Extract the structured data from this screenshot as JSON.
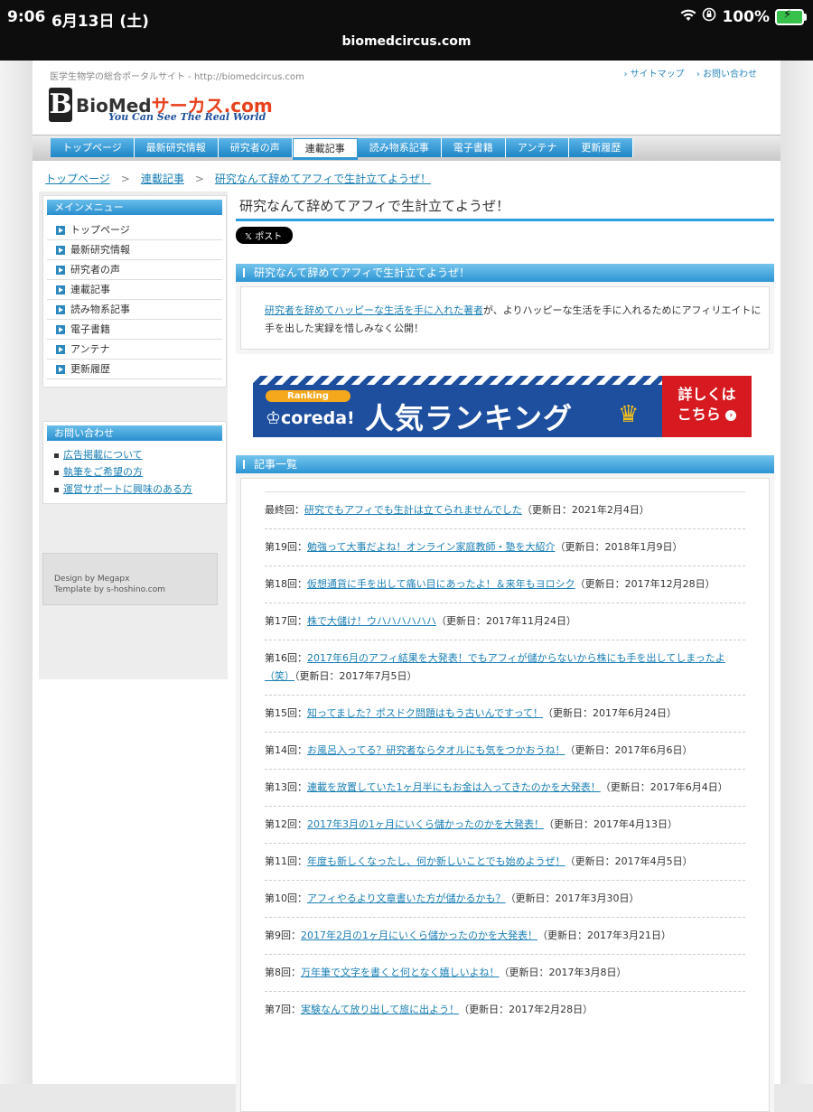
{
  "status": {
    "time": "9:06",
    "date": "6月13日 (土)",
    "battery": "100%"
  },
  "url": "biomedcircus.com",
  "header": {
    "tagline": "医学生物学の総合ポータルサイト - http://biomedcircus.com",
    "links": [
      "サイトマップ",
      "お問い合わせ"
    ],
    "logo_letter": "B",
    "logo_biomed": "BioMed",
    "logo_circus": "サーカス.com",
    "logo_sub": "You Can See The Real World"
  },
  "nav": [
    "トップページ",
    "最新研究情報",
    "研究者の声",
    "連載記事",
    "読み物系記事",
    "電子書籍",
    "アンテナ",
    "更新履歴"
  ],
  "breadcrumb": [
    "トップページ",
    "連載記事",
    "研究なんて辞めてアフィで生計立てようぜ！"
  ],
  "breadcrumb_sep": ">",
  "sidebar": {
    "menu_title": "メインメニュー",
    "menu": [
      "トップページ",
      "最新研究情報",
      "研究者の声",
      "連載記事",
      "読み物系記事",
      "電子書籍",
      "アンテナ",
      "更新履歴"
    ],
    "contact_title": "お問い合わせ",
    "contact": [
      "広告掲載について",
      "執筆をご希望の方",
      "運営サポートに興味のある方"
    ],
    "credit1": "Design by Megapx",
    "credit2": "Template by s-hoshino.com"
  },
  "main": {
    "title": "研究なんて辞めてアフィで生計立てようぜ！",
    "post_btn": "𝕏 ポスト",
    "section1": "研究なんて辞めてアフィで生計立てようぜ！",
    "intro_link": "研究者を辞めてハッピーな生活を手に入れた著者",
    "intro_rest": "が、よりハッピーな生活を手に入れるためにアフィリエイトに手を出した実録を惜しみなく公開！",
    "banner": {
      "ranking": "Ranking",
      "coreda": "♔coreda!",
      "ninki": "人気ランキング",
      "crown": "♛",
      "cta1": "詳しくは",
      "cta2": "こちら",
      "go": "›"
    },
    "section2": "記事一覧"
  },
  "articles": [
    {
      "no": "最終回：",
      "title": "研究でもアフィでも生計は立てられませんでした",
      "date": "（更新日：2021年2月4日）"
    },
    {
      "no": "第19回：",
      "title": "勉強って大事だよね！オンライン家庭教師・塾を大紹介",
      "date": "（更新日：2018年1月9日）"
    },
    {
      "no": "第18回：",
      "title": "仮想通貨に手を出して痛い目にあったよ！＆来年もヨロシク",
      "date": "（更新日：2017年12月28日）"
    },
    {
      "no": "第17回：",
      "title": "株で大儲け！ウハハハハハハ",
      "date": "（更新日：2017年11月24日）"
    },
    {
      "no": "第16回：",
      "title": "2017年6月のアフィ結果を大発表！でもアフィが儲からないから株にも手を出してしまったよ（笑）",
      "date": "（更新日：2017年7月5日）"
    },
    {
      "no": "第15回：",
      "title": "知ってました？ポスドク問題はもう古いんですって！",
      "date": "（更新日：2017年6月24日）"
    },
    {
      "no": "第14回：",
      "title": "お風呂入ってる？研究者ならタオルにも気をつかおうね！",
      "date": "（更新日：2017年6月6日）"
    },
    {
      "no": "第13回：",
      "title": "連載を放置していた1ヶ月半にもお金は入ってきたのかを大発表！",
      "date": "（更新日：2017年6月4日）"
    },
    {
      "no": "第12回：",
      "title": "2017年3月の1ヶ月にいくら儲かったのかを大発表！",
      "date": "（更新日：2017年4月13日）"
    },
    {
      "no": "第11回：",
      "title": "年度も新しくなったし、何か新しいことでも始めようぜ！",
      "date": "（更新日：2017年4月5日）"
    },
    {
      "no": "第10回：",
      "title": "アフィやるより文章書いた方が儲かるかも？",
      "date": "（更新日：2017年3月30日）"
    },
    {
      "no": "第9回：",
      "title": "2017年2月の1ヶ月にいくら儲かったのかを大発表！",
      "date": "（更新日：2017年3月21日）"
    },
    {
      "no": "第8回：",
      "title": "万年筆で文字を書くと何となく嬉しいよね！",
      "date": "（更新日：2017年3月8日）"
    },
    {
      "no": "第7回：",
      "title": "実験なんて放り出して旅に出よう！",
      "date": "（更新日：2017年2月28日）"
    }
  ]
}
